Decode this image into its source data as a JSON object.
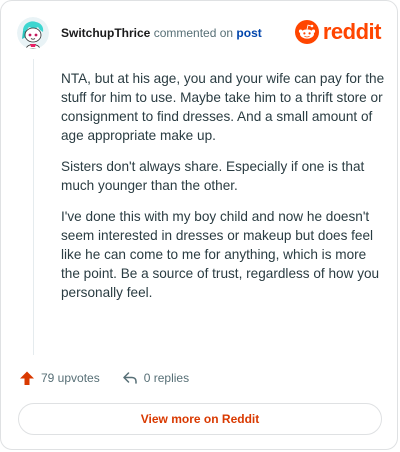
{
  "comment": {
    "username": "SwitchupThrice",
    "action_text": "commented on",
    "post_link": "post",
    "paragraphs": [
      "NTA, but at his age, you and your wife can pay for the stuff for him to use. Maybe take him to a thrift store or consignment to find dresses. And a small amount of age appropriate make up.",
      "Sisters don't always share. Especially if one is that much younger than the other.",
      "I've done this with my boy child and now he doesn't seem interested in dresses or makeup but does feel like he can come to me for anything, which is more the point. Be a source of trust, regardless of how you personally feel."
    ]
  },
  "brand": {
    "wordmark": "reddit",
    "color": "#ff4500"
  },
  "actions": {
    "upvotes": "79 upvotes",
    "replies": "0 replies"
  },
  "footer": {
    "view_more": "View more on Reddit"
  },
  "icons": {
    "avatar": "snoo-avatar-icon",
    "logo": "reddit-snoo-icon",
    "upvote": "upvote-arrow-icon",
    "reply": "reply-arrow-icon"
  }
}
